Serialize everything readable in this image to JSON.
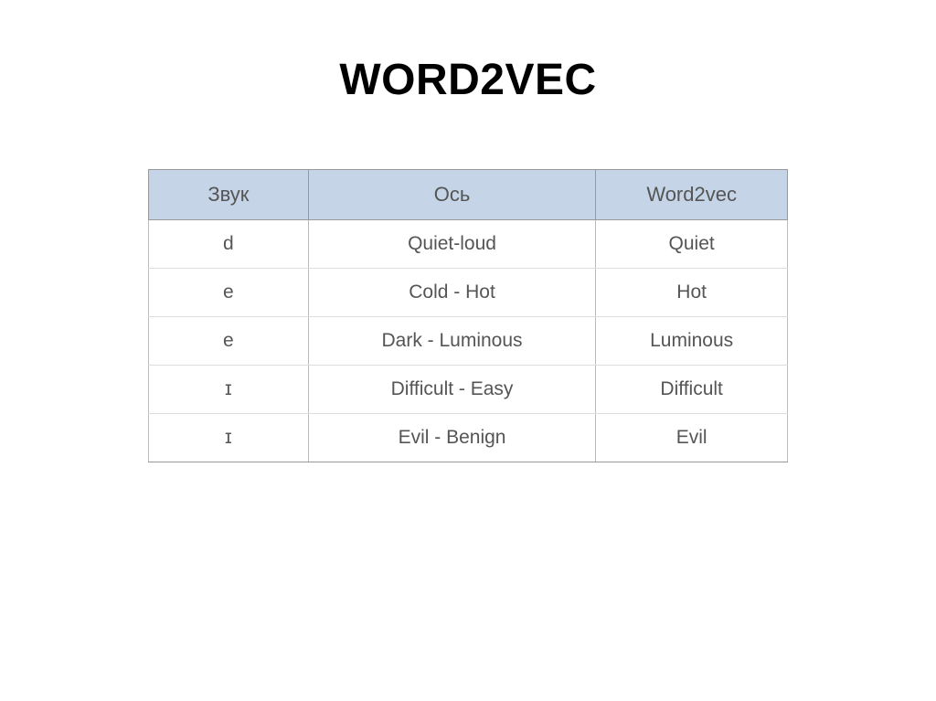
{
  "title": "WORD2VEC",
  "table": {
    "headers": [
      "Звук",
      "Ось",
      "Word2vec"
    ],
    "rows": [
      [
        "d",
        "Quiet-loud",
        "Quiet"
      ],
      [
        "e",
        "Cold - Hot",
        "Hot"
      ],
      [
        "e",
        "Dark - Luminous",
        "Luminous"
      ],
      [
        "ɪ",
        "Difficult - Easy",
        "Difficult"
      ],
      [
        "ɪ",
        "Evil - Benign",
        "Evil"
      ]
    ]
  }
}
